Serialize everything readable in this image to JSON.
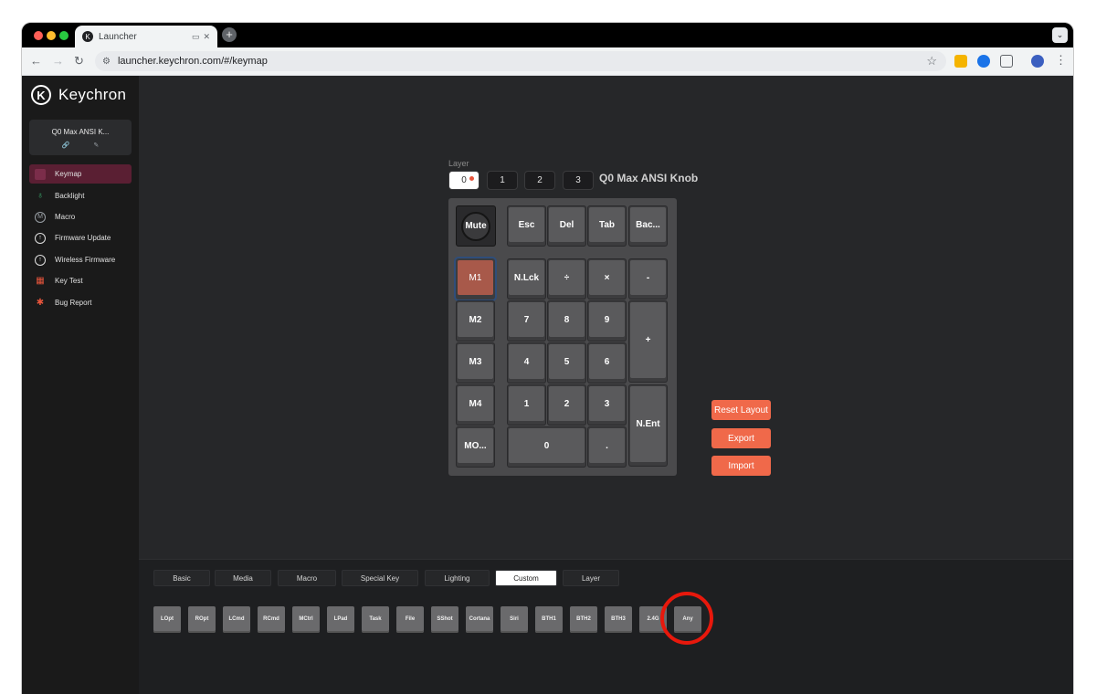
{
  "browser": {
    "tab_title": "Launcher",
    "new_tab": "+",
    "url": "launcher.keychron.com/#/keymap"
  },
  "sidebar": {
    "brand": "Keychron",
    "device_name": "Q0 Max ANSI K...",
    "items": [
      {
        "label": "Keymap",
        "icon": "keyboard-icon",
        "color": "#7b2d4a"
      },
      {
        "label": "Backlight",
        "icon": "bulb-icon",
        "color": "#3cb371"
      },
      {
        "label": "Macro",
        "icon": "macro-icon",
        "color": "#9aa0a6"
      },
      {
        "label": "Firmware Update",
        "icon": "upload-icon",
        "color": "#e0e0e0"
      },
      {
        "label": "Wireless Firmware",
        "icon": "upload-icon",
        "color": "#e0e0e0"
      },
      {
        "label": "Key Test",
        "icon": "calendar-icon",
        "color": "#e8553c"
      },
      {
        "label": "Bug Report",
        "icon": "bug-icon",
        "color": "#e8553c"
      }
    ]
  },
  "keymap": {
    "layer_label": "Layer",
    "layers": [
      "0",
      "1",
      "2",
      "3"
    ],
    "active_layer": "0",
    "keyboard_name": "Q0 Max ANSI Knob",
    "keys": {
      "mute": "Mute",
      "esc": "Esc",
      "del": "Del",
      "tab": "Tab",
      "backspace": "Bac...",
      "m1": "M1",
      "nlck": "N.Lck",
      "div": "÷",
      "mul": "×",
      "minus": "-",
      "m2": "M2",
      "k7": "7",
      "k8": "8",
      "k9": "9",
      "plus": "+",
      "m3": "M3",
      "k4": "4",
      "k5": "5",
      "k6": "6",
      "m4": "M4",
      "k1": "1",
      "k2": "2",
      "k3": "3",
      "nent": "N.Ent",
      "mo": "MO...",
      "k0": "0",
      "dot": "."
    },
    "actions": {
      "reset": "Reset Layout",
      "export": "Export",
      "import": "Import"
    }
  },
  "categories": {
    "tabs": [
      "Basic",
      "Media",
      "Macro",
      "Special Key",
      "Lighting",
      "Custom",
      "Layer"
    ],
    "active": "Custom",
    "keycodes": [
      "LOpt",
      "ROpt",
      "LCmd",
      "RCmd",
      "MCtrl",
      "LPad",
      "Task",
      "File",
      "SShot",
      "Cortana",
      "Siri",
      "BTH1",
      "BTH2",
      "BTH3",
      "2.4G",
      "Any"
    ]
  },
  "colors": {
    "accent": "#f0694a",
    "active_key": "#a8594a",
    "highlight_ring": "#e8180c"
  }
}
